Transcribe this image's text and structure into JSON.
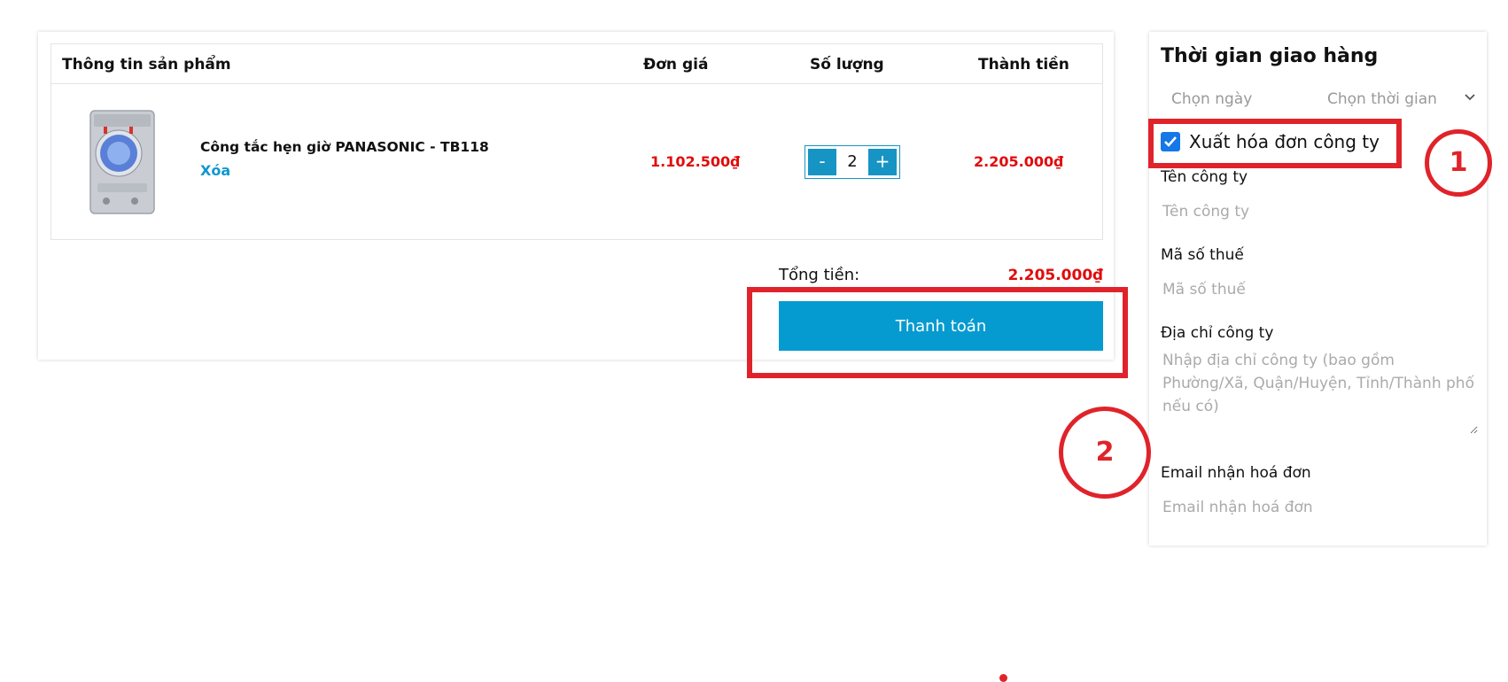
{
  "cart": {
    "headers": {
      "product": "Thông tin sản phẩm",
      "unit_price": "Đơn giá",
      "quantity": "Số lượng",
      "line_total": "Thành tiền"
    },
    "items": [
      {
        "name": "Công tắc hẹn giờ PANASONIC - TB118",
        "remove_label": "Xóa",
        "unit_price": "1.102.500₫",
        "quantity": "2",
        "minus_label": "-",
        "plus_label": "+",
        "line_total": "2.205.000₫"
      }
    ],
    "total_label": "Tổng tiền:",
    "total_value": "2.205.000₫",
    "checkout_label": "Thanh toán"
  },
  "delivery": {
    "title": "Thời gian giao hàng",
    "date_placeholder": "Chọn ngày",
    "time_placeholder": "Chọn thời gian",
    "invoice_checkbox_label": "Xuất hóa đơn công ty",
    "invoice_checked": true,
    "fields": {
      "company_name_label": "Tên công ty",
      "company_name_placeholder": "Tên công ty",
      "tax_code_label": "Mã số thuế",
      "tax_code_placeholder": "Mã số thuế",
      "address_label": "Địa chỉ công ty",
      "address_placeholder": "Nhập địa chỉ công ty (bao gồm Phường/Xã, Quận/Huyện, Tỉnh/Thành phố nếu có)",
      "email_label": "Email nhận hoá đơn",
      "email_placeholder": "Email nhận hoá đơn"
    }
  },
  "annotations": {
    "marker_1": "1",
    "marker_2": "2"
  },
  "colors": {
    "accent_blue": "#069bd0",
    "price_red": "#e10b0b",
    "annotation_red": "#e0232a",
    "checkbox_blue": "#1677e6"
  }
}
